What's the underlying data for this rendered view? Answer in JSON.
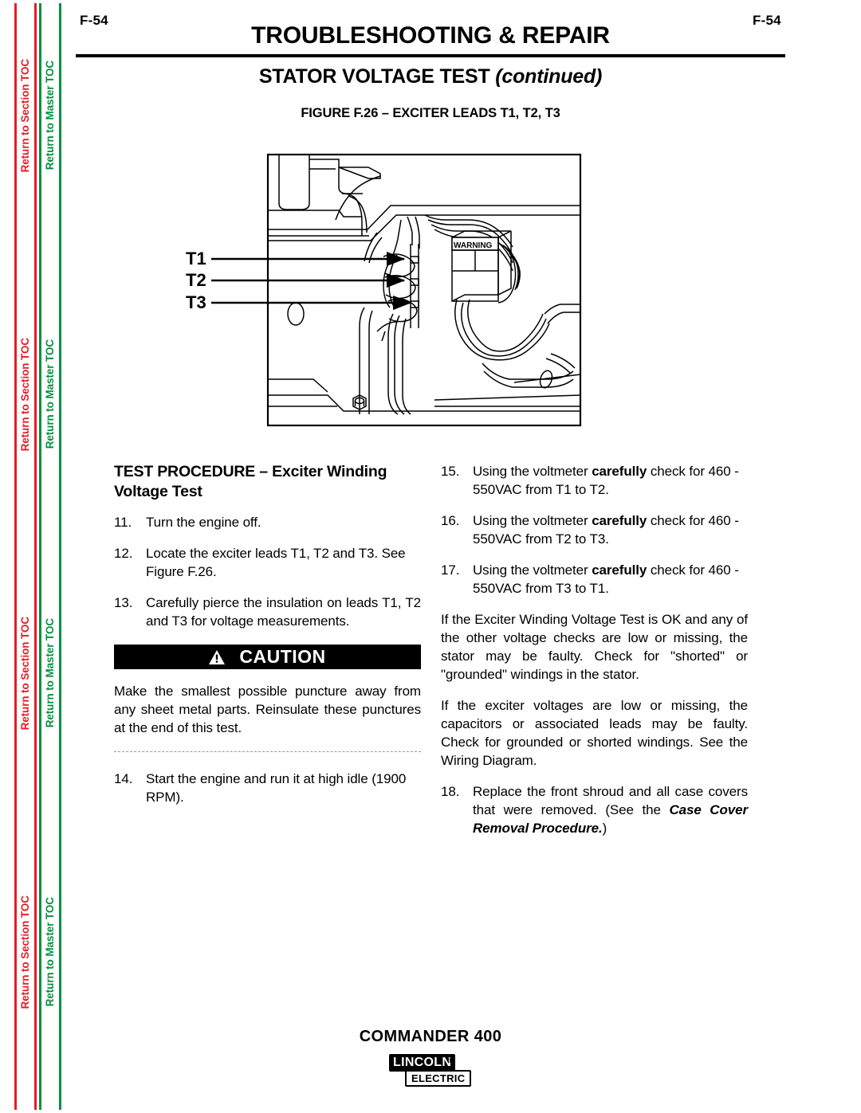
{
  "sidebar": {
    "section_toc_label": "Return to Section TOC",
    "master_toc_label": "Return to Master TOC",
    "section_color": "#e41e26",
    "master_color": "#00923f",
    "repeat_count": 4
  },
  "header": {
    "page_number_left": "F-54",
    "page_number_right": "F-54",
    "doc_title": "TROUBLESHOOTING & REPAIR",
    "section_title_main": "STATOR VOLTAGE TEST",
    "section_title_continued": "(continued)",
    "figure_caption": "FIGURE F.26 – EXCITER LEADS T1, T2, T3"
  },
  "figure": {
    "label_t1": "T1",
    "label_t2": "T2",
    "label_t3": "T3",
    "warning_decal": "WARNING"
  },
  "left_column": {
    "procedure_heading": "TEST PROCEDURE – Exciter Winding Voltage Test",
    "steps": [
      {
        "num": "11.",
        "text": "Turn the engine off."
      },
      {
        "num": "12.",
        "text": "Locate the exciter leads T1, T2 and T3.  See Figure F.26."
      },
      {
        "num": "13.",
        "text": "Carefully pierce the insulation on leads T1, T2 and T3 for voltage measurements."
      }
    ],
    "caution": {
      "label": "CAUTION",
      "icon": "warning-triangle-icon",
      "text": "Make the smallest possible puncture away from any sheet metal parts.  Reinsulate these punctures at the end of this test."
    },
    "post_caution_steps": [
      {
        "num": "14.",
        "text": "Start the engine and run it at high idle (1900 RPM)."
      }
    ]
  },
  "right_column": {
    "steps": [
      {
        "num": "15.",
        "pre": "Using the voltmeter ",
        "bold": "carefully",
        "post": " check for 460 - 550VAC from T1 to T2."
      },
      {
        "num": "16.",
        "pre": "Using the voltmeter ",
        "bold": "carefully",
        "post": " check for 460 - 550VAC from T2 to T3."
      },
      {
        "num": "17.",
        "pre": "Using the voltmeter ",
        "bold": "carefully",
        "post": " check for 460 - 550VAC from T3 to T1."
      }
    ],
    "paragraphs": [
      "If the Exciter Winding Voltage Test is OK and any of the other voltage checks are low or missing, the stator may be faulty.  Check for \"shorted\" or \"grounded\" windings in the stator.",
      "If the exciter voltages are low or missing, the capacitors or associated leads may be faulty. Check for grounded or shorted windings. See the Wiring Diagram."
    ],
    "final_step": {
      "num": "18.",
      "pre": "Replace the front shroud and all case covers that were removed.  (See the ",
      "bolditalic": "Case Cover Removal Procedure.",
      "post": ")"
    }
  },
  "footer": {
    "model_name": "COMMANDER 400",
    "brand_top": "LINCOLN",
    "brand_reg": "®",
    "brand_bottom": "ELECTRIC"
  }
}
